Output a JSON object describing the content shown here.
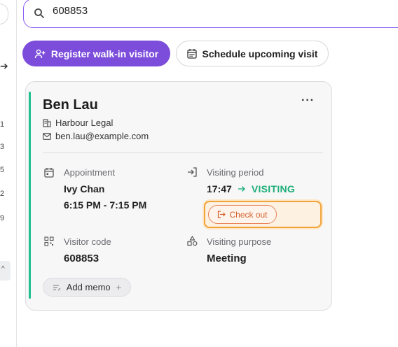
{
  "search": {
    "value": "608853"
  },
  "actions": {
    "register": "Register walk-in visitor",
    "schedule": "Schedule upcoming visit"
  },
  "sidebar": {
    "numbers": [
      "1",
      "3",
      "5",
      "2",
      "9"
    ]
  },
  "visitor": {
    "name": "Ben Lau",
    "company": "Harbour Legal",
    "email": "ben.lau@example.com",
    "appointment_label": "Appointment",
    "host": "Ivy Chan",
    "appointment_time": "6:15 PM - 7:15 PM",
    "period_label": "Visiting period",
    "checkin_time": "17:47",
    "status": "VISITING",
    "checkout_label": "Check out",
    "code_label": "Visitor code",
    "code": "608853",
    "purpose_label": "Visiting purpose",
    "purpose": "Meeting",
    "memo_label": "Add memo"
  },
  "colors": {
    "accent": "#7c4ddb",
    "status": "#1fae7a",
    "checkout": "#d2622e"
  }
}
